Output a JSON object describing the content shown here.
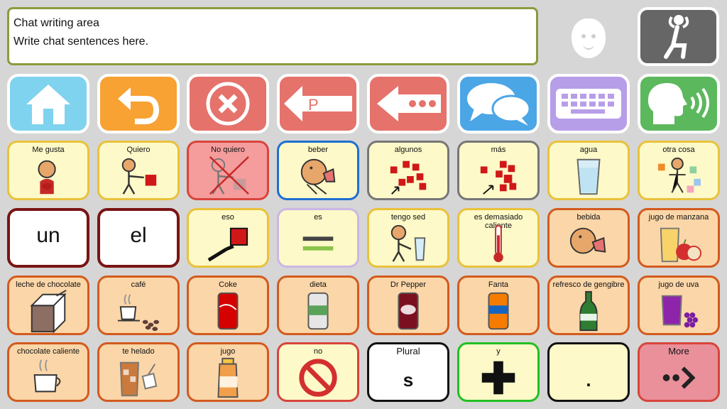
{
  "chat": {
    "title": "Chat writing area",
    "hint": "Write chat sentences here."
  },
  "topbar": {
    "face_icon": "face-icon",
    "rest_icon": "relax-person-icon"
  },
  "nav": [
    {
      "name": "home-button",
      "icon": "home-icon",
      "color": "#7fd3ee"
    },
    {
      "name": "back-button",
      "icon": "undo-arrow-icon",
      "color": "#f7a233"
    },
    {
      "name": "clear-button",
      "icon": "close-circle-icon",
      "color": "#e5726b"
    },
    {
      "name": "delete-word-button",
      "icon": "delete-word-arrow-icon",
      "color": "#e5726b"
    },
    {
      "name": "backspace-button",
      "icon": "backspace-dots-icon",
      "color": "#e5726b"
    },
    {
      "name": "chat-button",
      "icon": "speech-bubbles-icon",
      "color": "#4ba6e6"
    },
    {
      "name": "keyboard-button",
      "icon": "keyboard-icon",
      "color": "#b79ee8"
    },
    {
      "name": "speak-button",
      "icon": "speaking-head-icon",
      "color": "#5cb85c"
    }
  ],
  "rows": [
    [
      {
        "label": "Me gusta",
        "pic": "heart-person-icon"
      },
      {
        "label": "Quiero",
        "pic": "want-person-icon"
      },
      {
        "label": "No quiero",
        "pic": "no-want-icon"
      },
      {
        "label": "beber",
        "pic": "drinking-person-icon"
      },
      {
        "label": "algunos",
        "pic": "some-squares-icon"
      },
      {
        "label": "más",
        "pic": "more-squares-icon"
      },
      {
        "label": "agua",
        "pic": "water-glass-icon"
      },
      {
        "label": "otra cosa",
        "pic": "other-thing-icon"
      }
    ],
    [
      {
        "label": "un",
        "big": true
      },
      {
        "label": "el",
        "big": true
      },
      {
        "label": "eso",
        "pic": "that-pointing-icon"
      },
      {
        "label": "es",
        "pic": "equals-icon"
      },
      {
        "label": "tengo sed",
        "pic": "thirsty-person-icon"
      },
      {
        "label": "es demasiado caliente",
        "pic": "thermometer-icon"
      },
      {
        "label": "bebida",
        "pic": "drink-icon"
      },
      {
        "label": "jugo de manzana",
        "pic": "apple-juice-icon"
      }
    ],
    [
      {
        "label": "leche de chocolate",
        "pic": "chocolate-milk-icon"
      },
      {
        "label": "café",
        "pic": "coffee-icon"
      },
      {
        "label": "Coke",
        "pic": "coke-can-icon"
      },
      {
        "label": "dieta",
        "pic": "diet-can-icon"
      },
      {
        "label": "Dr Pepper",
        "pic": "dr-pepper-can-icon"
      },
      {
        "label": "Fanta",
        "pic": "fanta-can-icon"
      },
      {
        "label": "refresco de gengibre",
        "pic": "ginger-ale-bottle-icon"
      },
      {
        "label": "jugo de uva",
        "pic": "grape-juice-icon"
      }
    ],
    [
      {
        "label": "chocolate caliente",
        "pic": "hot-chocolate-icon"
      },
      {
        "label": "te helado",
        "pic": "iced-tea-icon"
      },
      {
        "label": "jugo",
        "pic": "juice-bottle-icon"
      },
      {
        "label": "no",
        "pic": "no-symbol-icon"
      },
      {
        "label": "Plural",
        "pic": "plural-s-icon",
        "sub": "s"
      },
      {
        "label": "y",
        "pic": "plus-icon"
      },
      {
        "label": "",
        "pic": "period-icon",
        "sub": "."
      },
      {
        "label": "More",
        "pic": "more-arrow-icon"
      }
    ]
  ]
}
